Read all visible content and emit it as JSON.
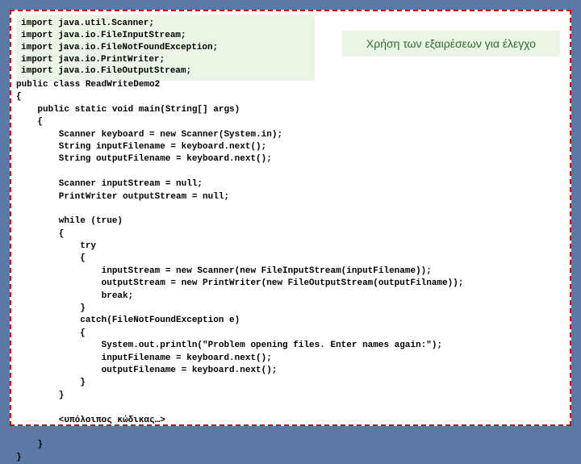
{
  "imports": {
    "l1": "import java.util.Scanner;",
    "l2": "import java.io.FileInputStream;",
    "l3": "import java.io.FileNotFoundException;",
    "l4": "import java.io.PrintWriter;",
    "l5": "import java.io.FileOutputStream;"
  },
  "callout": "Χρήση των εξαιρέσεων για έλεγχο",
  "code": "public class ReadWriteDemo2\n{\n    public static void main(String[] args)\n    {\n        Scanner keyboard = new Scanner(System.in);\n        String inputFilename = keyboard.next();\n        String outputFilename = keyboard.next();\n\n        Scanner inputStream = null;\n        PrintWriter outputStream = null;\n\n        while (true)\n        {\n            try\n            {\n                inputStream = new Scanner(new FileInputStream(inputFilename));\n                outputStream = new PrintWriter(new FileOutputStream(outputFilname));\n                break;\n            }\n            catch(FileNotFoundException e)\n            {\n                System.out.println(\"Problem opening files. Enter names again:\");\n                inputFilename = keyboard.next();\n                outputFilename = keyboard.next();\n            }\n        }\n\n        <υπόλοιπος κώδικας…>\n\n    }\n}"
}
